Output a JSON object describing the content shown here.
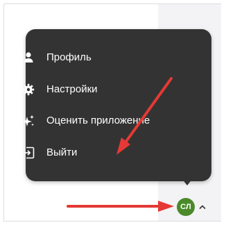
{
  "menu": {
    "items": [
      {
        "label": "Профиль",
        "icon": "person-icon"
      },
      {
        "label": "Настройки",
        "icon": "gear-icon"
      },
      {
        "label": "Оценить приложение",
        "icon": "sparkle-icon"
      },
      {
        "label": "Выйти",
        "icon": "logout-icon"
      }
    ]
  },
  "user": {
    "initials": "СЛ",
    "avatar_color": "#4b8a2a"
  },
  "colors": {
    "menu_background": "#333333",
    "annotation_arrow": "#e53935"
  }
}
